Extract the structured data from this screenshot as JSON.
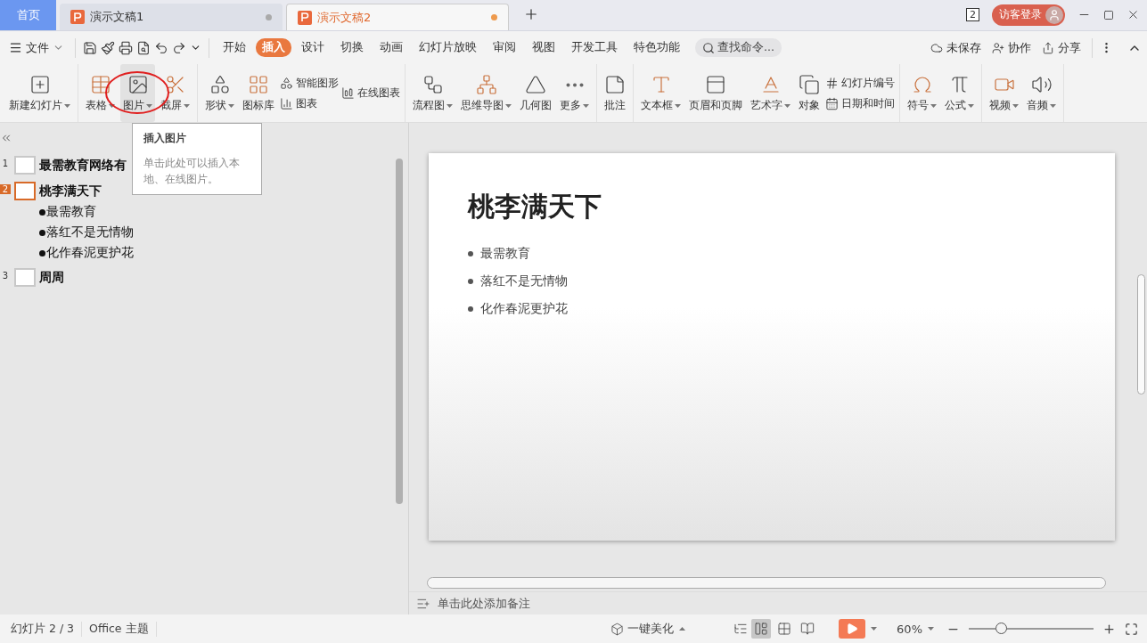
{
  "doc_tabs": [
    {
      "label": "首页",
      "kind": "home",
      "selected": false
    },
    {
      "label": "演示文稿1",
      "kind": "doc",
      "selected": false
    },
    {
      "label": "演示文稿2",
      "kind": "doc",
      "selected": true
    }
  ],
  "window_controls": {
    "window_count": "2",
    "login": "访客登录"
  },
  "menu": {
    "file": "文件",
    "tabs": [
      {
        "label": "开始",
        "selected": false
      },
      {
        "label": "插入",
        "selected": true
      },
      {
        "label": "设计",
        "selected": false
      },
      {
        "label": "切换",
        "selected": false
      },
      {
        "label": "动画",
        "selected": false
      },
      {
        "label": "幻灯片放映",
        "selected": false
      },
      {
        "label": "审阅",
        "selected": false
      },
      {
        "label": "视图",
        "selected": false
      },
      {
        "label": "开发工具",
        "selected": false
      },
      {
        "label": "特色功能",
        "selected": false
      }
    ],
    "search": {
      "placeholder": "查找命令..."
    },
    "actions": [
      "未保存",
      "协作",
      "分享"
    ]
  },
  "ribbon": [
    {
      "items": [
        {
          "kind": "large",
          "label": "新建幻灯片",
          "dropdown": true,
          "hover": false
        }
      ]
    },
    {
      "items": [
        {
          "kind": "large",
          "label": "表格",
          "dropdown": true,
          "hover": false
        },
        {
          "kind": "large",
          "label": "图片",
          "dropdown": true,
          "hover": true
        },
        {
          "kind": "large",
          "label": "截屏",
          "dropdown": true,
          "hover": false
        }
      ]
    },
    {
      "items": [
        {
          "kind": "large",
          "label": "形状",
          "dropdown": true,
          "hover": false
        },
        {
          "kind": "large",
          "label": "图标库",
          "dropdown": false,
          "hover": false
        },
        {
          "kind": "stack",
          "rows": [
            "智能图形",
            "图表"
          ]
        },
        {
          "kind": "stack",
          "rows": [
            "在线图表"
          ]
        }
      ]
    },
    {
      "items": [
        {
          "kind": "large",
          "label": "流程图",
          "dropdown": true,
          "hover": false
        },
        {
          "kind": "large",
          "label": "思维导图",
          "dropdown": true,
          "hover": false
        },
        {
          "kind": "large",
          "label": "几何图",
          "dropdown": false,
          "hover": false
        },
        {
          "kind": "large",
          "label": "更多",
          "dropdown": true,
          "hover": false
        }
      ]
    },
    {
      "items": [
        {
          "kind": "large",
          "label": "批注",
          "dropdown": false,
          "hover": false
        }
      ]
    },
    {
      "items": [
        {
          "kind": "large",
          "label": "文本框",
          "dropdown": true,
          "hover": false
        },
        {
          "kind": "large",
          "label": "页眉和页脚",
          "dropdown": false,
          "hover": false
        },
        {
          "kind": "large",
          "label": "艺术字",
          "dropdown": true,
          "hover": false
        },
        {
          "kind": "large",
          "label": "对象",
          "dropdown": false,
          "hover": false
        },
        {
          "kind": "stack",
          "rows": [
            "幻灯片编号",
            "日期和时间"
          ]
        }
      ]
    },
    {
      "items": [
        {
          "kind": "large",
          "label": "符号",
          "dropdown": true,
          "hover": false
        },
        {
          "kind": "large",
          "label": "公式",
          "dropdown": true,
          "hover": false
        }
      ]
    },
    {
      "items": [
        {
          "kind": "large",
          "label": "视频",
          "dropdown": true,
          "hover": false
        },
        {
          "kind": "large",
          "label": "音频",
          "dropdown": true,
          "hover": false
        }
      ]
    }
  ],
  "tooltip": {
    "title": "插入图片",
    "text": "单击此处可以插入本地、在线图片。"
  },
  "outline": [
    {
      "number": "1",
      "selected": false,
      "title": "最需教育网络有"
    },
    {
      "number": "2",
      "selected": true,
      "title": "桃李满天下",
      "bullets": [
        "最需教育",
        "落红不是无情物",
        "化作春泥更护花"
      ]
    },
    {
      "number": "3",
      "selected": false,
      "title": "周周"
    }
  ],
  "slide": {
    "title": "桃李满天下",
    "bullets": [
      "最需教育",
      "落红不是无情物",
      "化作春泥更护花"
    ]
  },
  "notes": {
    "placeholder": "单击此处添加备注"
  },
  "status_bar": {
    "slide_info": "幻灯片 2 / 3",
    "theme": "Office 主题",
    "beautify": "一键美化",
    "views": [
      {
        "selected": true
      },
      {
        "selected": false
      },
      {
        "selected": false
      }
    ],
    "zoom": "60%",
    "zoom_slider": {
      "level": 0.26
    }
  }
}
